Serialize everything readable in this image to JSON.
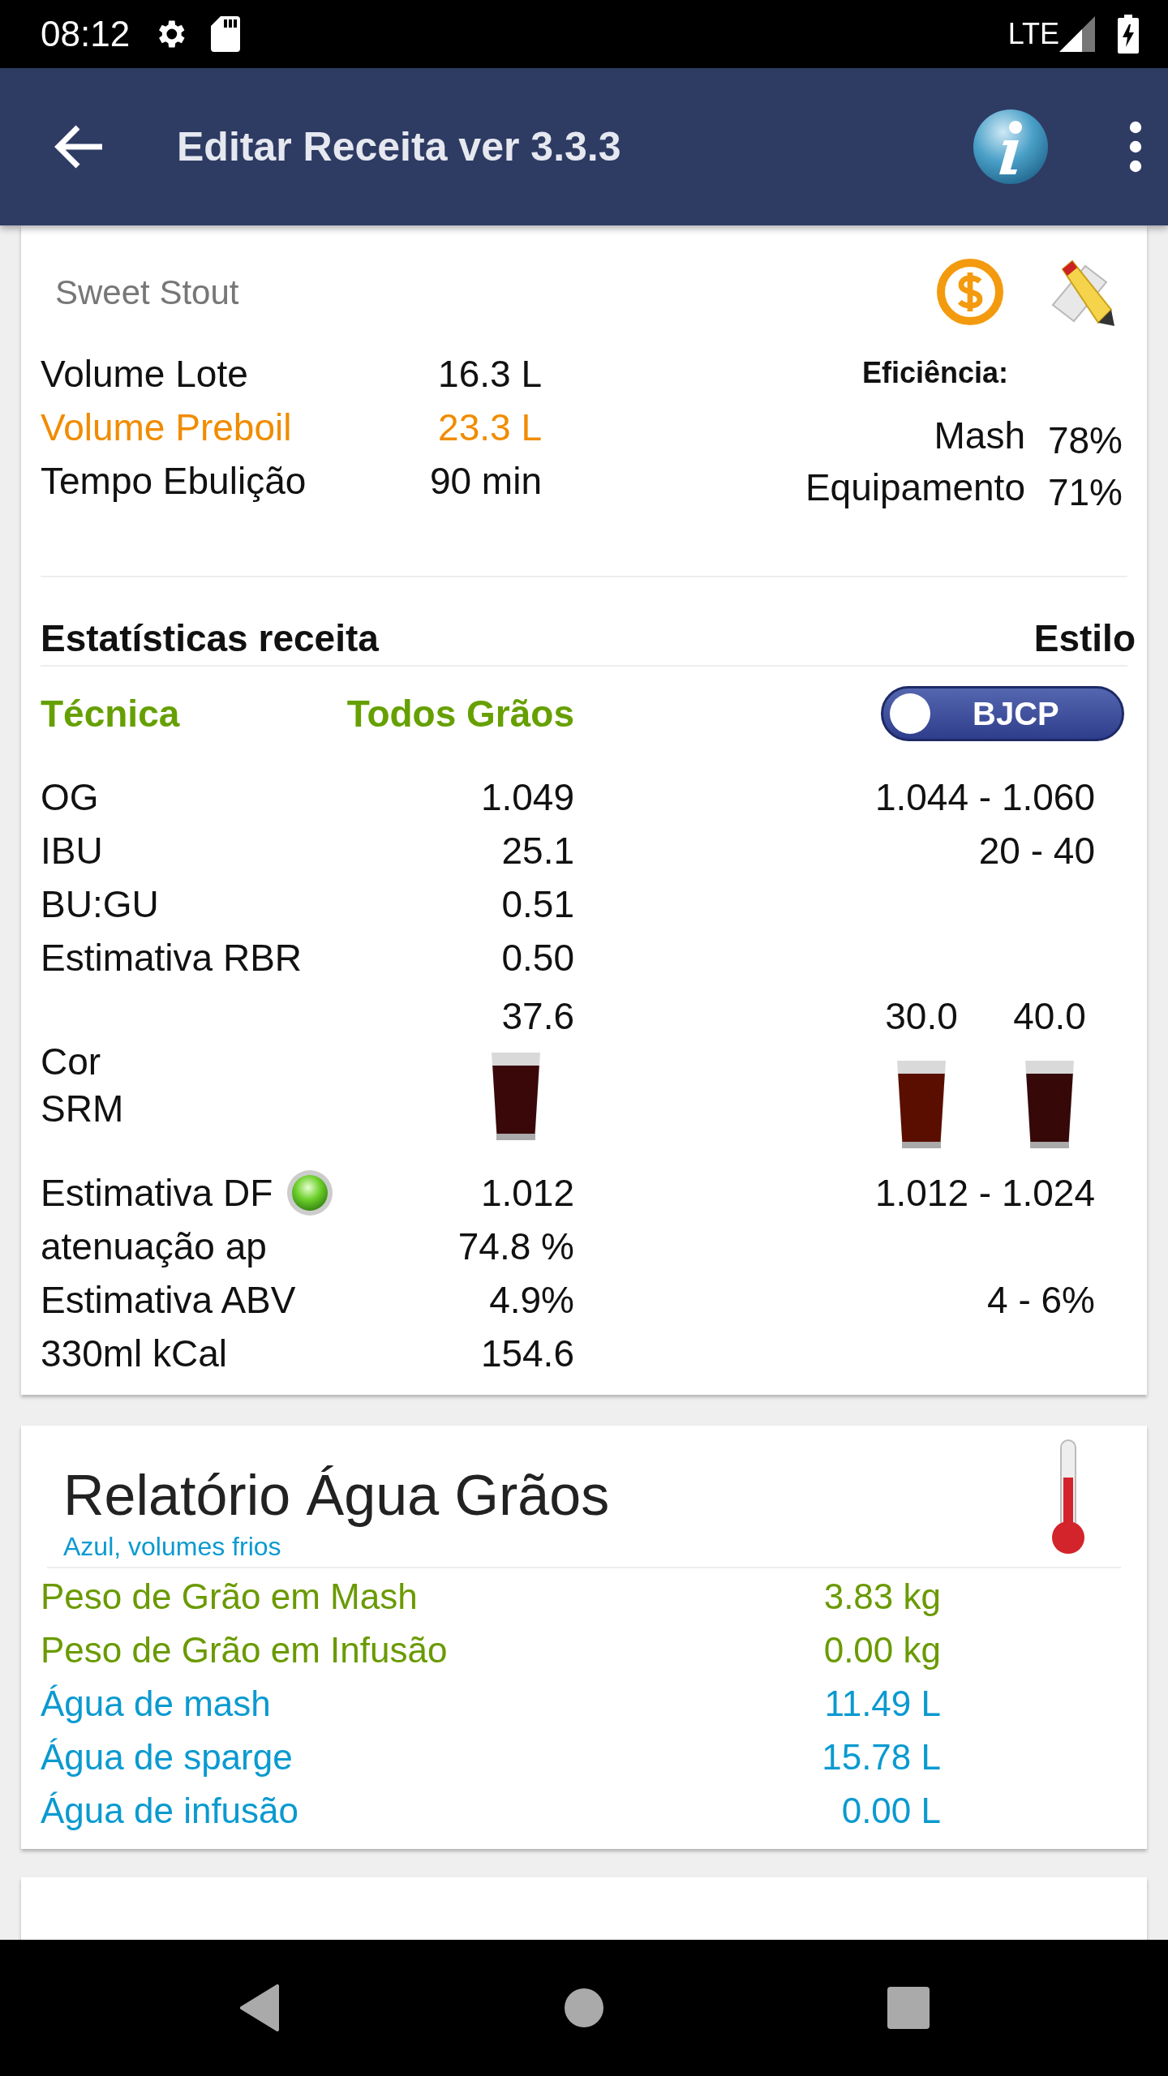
{
  "status_bar": {
    "time": "08:12",
    "network": "LTE"
  },
  "app_bar": {
    "title": "Editar Receita ver 3.3.3"
  },
  "recipe": {
    "style_name": "Sweet Stout",
    "volumes": [
      {
        "label": "Volume Lote",
        "value": "16.3 L",
        "highlight": false
      },
      {
        "label": "Volume Preboil",
        "value": "23.3 L",
        "highlight": true
      },
      {
        "label": "Tempo Ebulição",
        "value": "90 min",
        "highlight": false
      }
    ],
    "efficiency": {
      "title": "Eficiência:",
      "items": [
        {
          "label": "Mash",
          "value": "78%"
        },
        {
          "label": "Equipamento",
          "value": "71%"
        }
      ]
    },
    "stats_title": "Estatísticas receita",
    "style_title": "Estilo",
    "technique": {
      "label": "Técnica",
      "value": "Todos Grãos"
    },
    "bjcp_toggle": {
      "label": "BJCP",
      "on": false
    },
    "stats": [
      {
        "kind": "text",
        "label": "OG",
        "value": "1.049",
        "style_range": "1.044 - 1.060"
      },
      {
        "kind": "text",
        "label": "IBU",
        "value": "25.1",
        "style_range": "20 - 40"
      },
      {
        "kind": "text",
        "label": "BU:GU",
        "value": "0.51"
      },
      {
        "kind": "text",
        "label": "Estimativa RBR",
        "value": "0.50"
      },
      {
        "kind": "color",
        "label_lines": [
          "Cor",
          "SRM"
        ],
        "value": "37.6",
        "color": "#3a0808",
        "style_low": {
          "value": "30.0",
          "color": "#5a0e00"
        },
        "style_high": {
          "value": "40.0",
          "color": "#360808"
        }
      },
      {
        "kind": "text",
        "label": "Estimativa DF",
        "indicator": true,
        "value": "1.012",
        "style_range": "1.012 - 1.024"
      },
      {
        "kind": "text",
        "label": "atenuação ap",
        "value": "74.8 %"
      },
      {
        "kind": "text",
        "label": "Estimativa ABV",
        "value": "4.9%",
        "style_range": "4 - 6%"
      },
      {
        "kind": "text",
        "label": "330ml kCal",
        "value": "154.6"
      }
    ]
  },
  "water_report": {
    "title": "Relatório Água Grãos",
    "subtitle": "Azul, volumes frios",
    "rows": [
      {
        "kind": "grain",
        "label": "Peso de Grão em Mash",
        "value": "3.83 kg"
      },
      {
        "kind": "grain",
        "label": "Peso de Grão em Infusão",
        "value": "0.00 kg"
      },
      {
        "kind": "water",
        "label": "Água de mash",
        "value": "11.49 L"
      },
      {
        "kind": "water",
        "label": "Água de sparge",
        "value": "15.78 L"
      },
      {
        "kind": "water",
        "label": "Água de infusão",
        "value": "0.00 L"
      }
    ]
  }
}
